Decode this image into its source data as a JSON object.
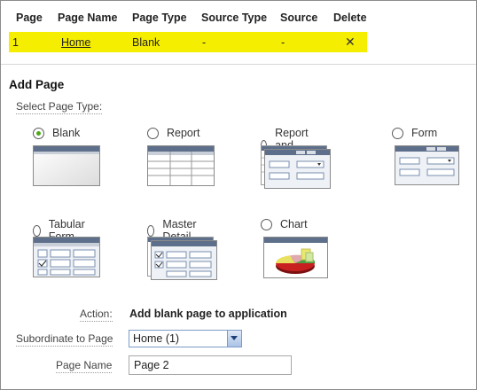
{
  "pages_table": {
    "headers": [
      "Page",
      "Page Name",
      "Page Type",
      "Source Type",
      "Source",
      "Delete"
    ],
    "rows": [
      {
        "page": "1",
        "page_name": "Home",
        "page_type": "Blank",
        "source_type": "-",
        "source": "-",
        "delete": "✕"
      }
    ]
  },
  "add_page": {
    "title": "Add Page",
    "select_type_label": "Select Page Type:",
    "options": [
      {
        "label": "Blank",
        "checked": true
      },
      {
        "label": "Report",
        "checked": false
      },
      {
        "label": "Report and Form",
        "checked": false
      },
      {
        "label": "Form",
        "checked": false
      },
      {
        "label": "Tabular Form",
        "checked": false
      },
      {
        "label": "Master Detail",
        "checked": false
      },
      {
        "label": "Chart",
        "checked": false
      }
    ],
    "action_label": "Action:",
    "action_value": "Add blank page to application",
    "subordinate_label": "Subordinate to Page",
    "subordinate_value": "Home (1)",
    "page_name_label": "Page Name",
    "page_name_value": "Page 2"
  },
  "colors": {
    "highlight": "#f6ee00",
    "radio_checked": "#4fa81c",
    "thumb_header": "#5d6f8a"
  }
}
